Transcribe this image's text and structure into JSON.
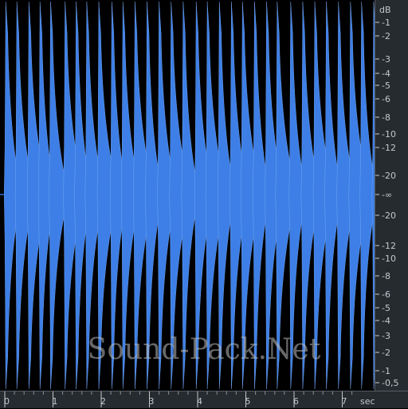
{
  "colors": {
    "background": "#000000",
    "waveform": "#3d7fe6",
    "waveform_edge": "#7fb0ff",
    "centerline": "#1d4f9e",
    "ruler_bg": "#262b30",
    "ruler_text": "#c4c8cc"
  },
  "db_ruler": {
    "unit": "dB",
    "top_labels": [
      "-1",
      "-2",
      "-3",
      "-4",
      "-5",
      "-6",
      "-8",
      "-10",
      "-12",
      "-20"
    ],
    "center_label": "-∞",
    "bottom_labels": [
      "-20",
      "-12",
      "-10",
      "-8",
      "-6",
      "-5",
      "-4",
      "-3",
      "-2",
      "-1",
      "-0,5"
    ]
  },
  "time_ruler": {
    "unit": "sec",
    "labels": [
      "0",
      "1",
      "2",
      "3",
      "4",
      "5",
      "6",
      "7"
    ]
  },
  "watermark": "Sound-Pack.Net",
  "chart_data": {
    "type": "waveform",
    "x_unit": "sec",
    "x_range": [
      0,
      7.75
    ],
    "transient_times_sec": [
      0.02,
      0.25,
      0.5,
      0.73,
      0.95,
      1.25,
      1.48,
      1.7,
      1.95,
      2.22,
      2.45,
      2.7,
      2.95,
      3.2,
      3.45,
      3.7,
      3.97,
      4.2,
      4.45,
      4.7,
      4.93,
      5.18,
      5.43,
      5.65,
      5.93,
      6.18,
      6.43,
      6.67,
      6.92,
      7.17,
      7.4,
      7.65
    ]
  }
}
